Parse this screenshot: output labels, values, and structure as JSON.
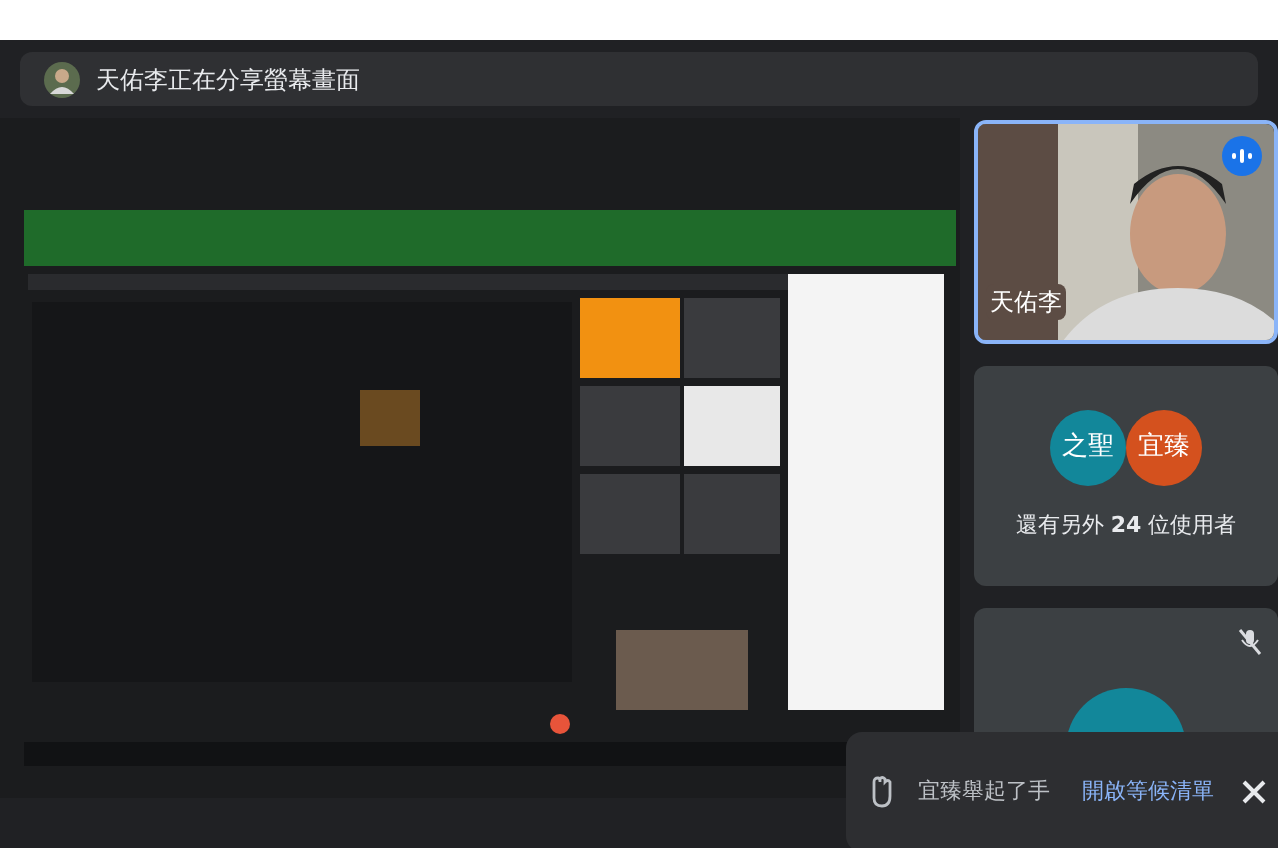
{
  "banner": {
    "text": "天佑李正在分享螢幕畫面"
  },
  "presenter_tile": {
    "name": "天佑李",
    "speaking": true
  },
  "others_tile": {
    "avatars": [
      {
        "initials": "之聖",
        "color": "#12879a"
      },
      {
        "initials": "宜臻",
        "color": "#d4511e"
      }
    ],
    "text": "還有另外 **24** 位使用者"
  },
  "muted_tile": {
    "muted": true,
    "color": "#12879a"
  },
  "toast": {
    "message": "宜臻舉起了手",
    "action": "開啟等候清單"
  }
}
